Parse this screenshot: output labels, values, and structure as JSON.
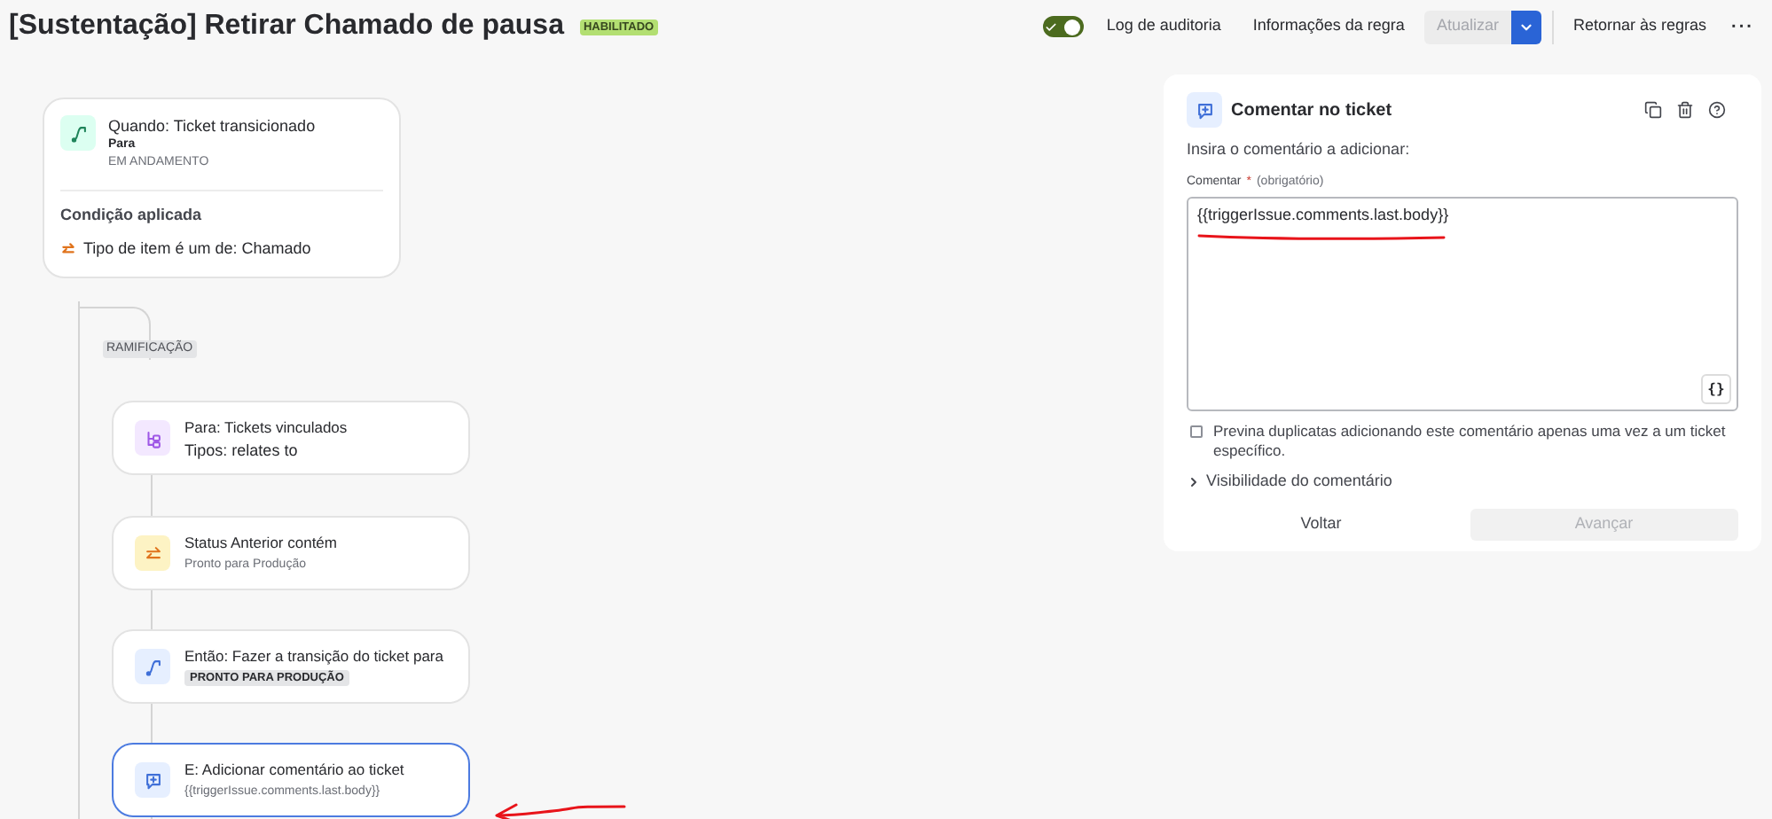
{
  "header": {
    "title": "[Sustentação] Retirar Chamado de pausa",
    "status_badge": "HABILITADO",
    "toggle_on": true,
    "links": [
      "Log de auditoria",
      "Informações da regra"
    ],
    "update_button": {
      "label": "Atualizar",
      "disabled": true
    },
    "back_link": "Retornar às regras",
    "more": "···"
  },
  "trigger": {
    "title": "Quando: Ticket transicionado",
    "label": "Para",
    "value": "EM ANDAMENTO",
    "condition_heading": "Condição aplicada",
    "condition": "Tipo de item é um de: Chamado"
  },
  "branch_label": "RAMIFICAÇÃO",
  "steps": [
    {
      "kind": "linked",
      "title": "Para: Tickets vinculados",
      "subtitle": "Tipos: relates to",
      "selected": false
    },
    {
      "kind": "condition",
      "title": "Status Anterior contém",
      "subtitle": "Pronto para Produção",
      "selected": false
    },
    {
      "kind": "transition",
      "title": "Então: Fazer a transição do ticket para",
      "tag": "PRONTO PARA PRODUÇÃO",
      "selected": false
    },
    {
      "kind": "comment",
      "title": "E: Adicionar comentário ao ticket",
      "subtitle": "{{triggerIssue.comments.last.body}}",
      "selected": true
    }
  ],
  "panel": {
    "title": "Comentar no ticket",
    "prompt": "Insira o comentário a adicionar:",
    "field_label": "Comentar",
    "required_mark": "*",
    "required_note": "(obrigatório)",
    "value": "{{triggerIssue.comments.last.body}}",
    "smart_value_button": "{}",
    "checkbox": {
      "label": "Previna duplicatas adicionando este comentário apenas uma vez a um ticket específico.",
      "checked": false
    },
    "expander": {
      "label": "Visibilidade do comentário",
      "expanded": false
    },
    "back_button": "Voltar",
    "next_button": {
      "label": "Avançar",
      "disabled": true
    }
  }
}
